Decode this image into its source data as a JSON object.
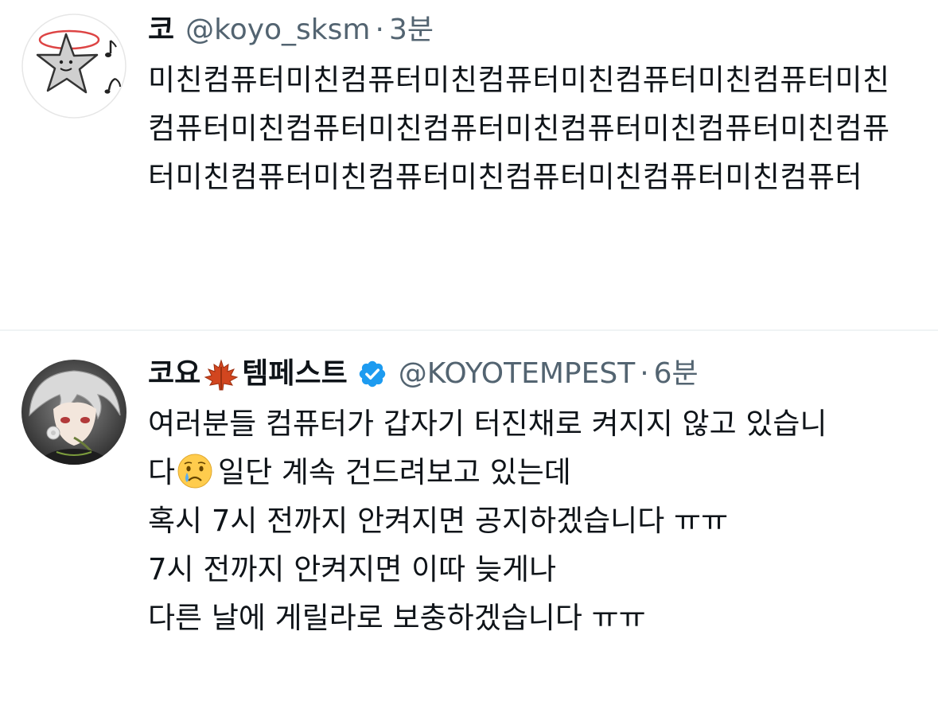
{
  "tweets": [
    {
      "display_name": "코",
      "handle": "@koyo_sksm",
      "separator": "·",
      "time": "3분",
      "text": "미친컴퓨터미친컴퓨터미친컴퓨터미친컴퓨터미친컴퓨터미친컴퓨터미친컴퓨터미친컴퓨터미친컴퓨터미친컴퓨터미친컴퓨터미친컴퓨터미친컴퓨터미친컴퓨터미친컴퓨터미친컴퓨터",
      "avatar_icon": "star-doodle-avatar"
    },
    {
      "display_name_part1": "코요",
      "display_name_emoji": "maple-leaf-icon",
      "display_name_part2": "템페스트",
      "verified": true,
      "verified_color": "#1d9bf0",
      "handle": "@KOYOTEMPEST",
      "separator": "·",
      "time": "6분",
      "lines": [
        "여러분들 컴퓨터가 갑자기 터진채로 켜지지 않고 있습니",
        "다",
        "일단 계속 건드려보고 있는데",
        "혹시 7시 전까지 안켜지면 공지하겠습니다 ㅠㅠ",
        "7시 전까지 안켜지면 이따 늦게나",
        "다른 날에 게릴라로 보충하겠습니다 ㅠㅠ"
      ],
      "inline_emoji": "crying-face-icon",
      "avatar_icon": "anime-character-avatar"
    }
  ],
  "colors": {
    "text": "#0f1419",
    "secondary": "#536471",
    "divider": "#eff3f4",
    "verified": "#1d9bf0"
  }
}
